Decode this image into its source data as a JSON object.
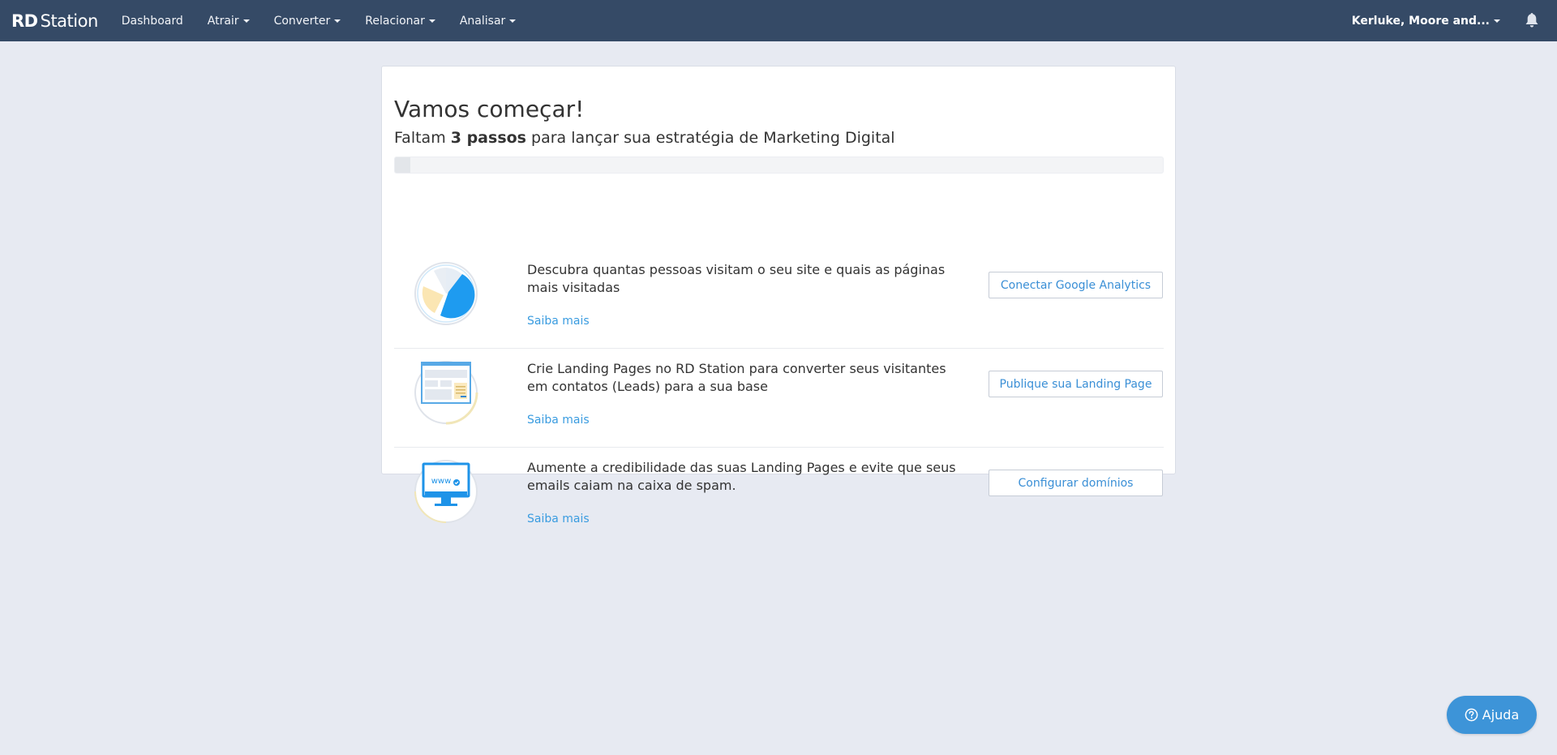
{
  "brand": {
    "name_bold": "RD",
    "name_rest": "Station"
  },
  "nav": {
    "items": [
      {
        "label": "Dashboard",
        "has_caret": false
      },
      {
        "label": "Atrair",
        "has_caret": true
      },
      {
        "label": "Converter",
        "has_caret": true
      },
      {
        "label": "Relacionar",
        "has_caret": true
      },
      {
        "label": "Analisar",
        "has_caret": true
      }
    ],
    "account_label": "Kerluke, Moore and...",
    "bell_icon": "bell-icon"
  },
  "onboarding": {
    "title": "Vamos começar!",
    "subtitle_prefix": "Faltam ",
    "subtitle_bold": "3 passos",
    "subtitle_suffix": " para lançar sua estratégia de Marketing Digital",
    "progress_fraction": 0.02,
    "steps": [
      {
        "icon": "pie-chart-icon",
        "text": "Descubra quantas pessoas visitam o seu site e quais as páginas mais visitadas",
        "link": "Saiba mais",
        "button": "Conectar Google Analytics"
      },
      {
        "icon": "landing-page-icon",
        "text": "Crie Landing Pages no RD Station para converter seus visitantes em contatos (Leads) para a sua base",
        "link": "Saiba mais",
        "button": "Publique sua Landing Page"
      },
      {
        "icon": "domain-monitor-icon",
        "text": "Aumente a credibilidade das suas Landing Pages e evite que seus emails caiam na caixa de spam.",
        "link": "Saiba mais",
        "button": "Configurar domínios"
      }
    ]
  },
  "help": {
    "label": "Ajuda",
    "icon": "question-circle-icon"
  },
  "colors": {
    "topbar": "#354a66",
    "background": "#e7eaf2",
    "link": "#3a9ce0",
    "help_button": "#3d94d8"
  }
}
